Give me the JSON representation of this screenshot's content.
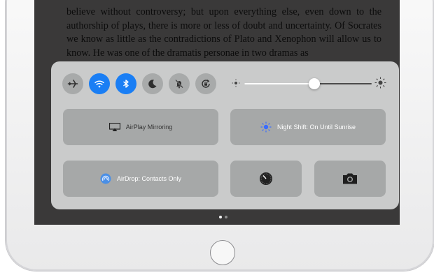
{
  "reader": {
    "text": "believe without controversy; but upon everything else, even down to the authorship of plays, there is more or less of doubt and uncertainty. Of Socrates we know as little as the contradictions of Plato and Xenophon will allow us to know. He was one of the dramatis personae in two dramas as"
  },
  "control_center": {
    "toggles": [
      {
        "icon": "airplane-icon",
        "on": false
      },
      {
        "icon": "wifi-icon",
        "on": true
      },
      {
        "icon": "bluetooth-icon",
        "on": true
      },
      {
        "icon": "moon-icon",
        "on": false
      },
      {
        "icon": "mute-bell-icon",
        "on": false
      },
      {
        "icon": "rotation-lock-icon",
        "on": false
      }
    ],
    "brightness": 0.55,
    "tiles": {
      "airplay_label": "AirPlay Mirroring",
      "night_shift_label": "Night Shift: On Until Sunrise",
      "airdrop_label": "AirDrop: Contacts Only",
      "timer_icon": "timer-icon",
      "camera_icon": "camera-icon"
    },
    "colors": {
      "active_blue": "#1a7ef4",
      "night_shift_accent": "#3a6cff",
      "airdrop_accent": "#4a8fe6"
    }
  },
  "pager": {
    "pages": 2,
    "active": 0
  }
}
